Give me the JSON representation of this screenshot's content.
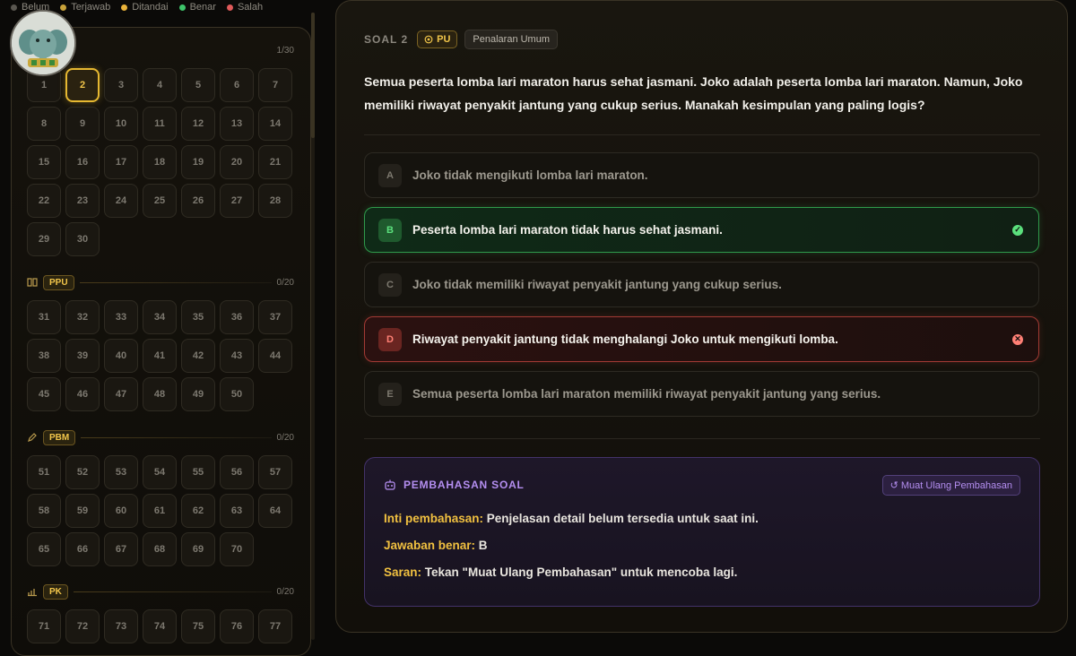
{
  "legend": [
    {
      "label": "Belum",
      "color": "#5a5750"
    },
    {
      "label": "Terjawab",
      "color": "#c8a23a"
    },
    {
      "label": "Ditandai",
      "color": "#e8b23a"
    },
    {
      "label": "Benar",
      "color": "#3ec46a"
    },
    {
      "label": "Salah",
      "color": "#e05a5a"
    }
  ],
  "sections": [
    {
      "tag": "",
      "icon": "",
      "count": "1/30",
      "start": 1,
      "end": 30,
      "active": 2
    },
    {
      "tag": "PPU",
      "icon": "book-icon",
      "count": "0/20",
      "start": 31,
      "end": 50
    },
    {
      "tag": "PBM",
      "icon": "pencil-icon",
      "count": "0/20",
      "start": 51,
      "end": 70
    },
    {
      "tag": "PK",
      "icon": "chart-icon",
      "count": "0/20",
      "start": 71,
      "end": 77
    }
  ],
  "question": {
    "number_label": "SOAL 2",
    "pu_badge": "PU",
    "category": "Penalaran Umum",
    "text": "Semua peserta lomba lari maraton harus sehat jasmani. Joko adalah peserta lomba lari maraton. Namun, Joko memiliki riwayat penyakit jantung yang cukup serius. Manakah kesimpulan yang paling logis?"
  },
  "options": [
    {
      "letter": "A",
      "text": "Joko tidak mengikuti lomba lari maraton.",
      "state": "none"
    },
    {
      "letter": "B",
      "text": "Peserta lomba lari maraton tidak harus sehat jasmani.",
      "state": "correct"
    },
    {
      "letter": "C",
      "text": "Joko tidak memiliki riwayat penyakit jantung yang cukup serius.",
      "state": "none"
    },
    {
      "letter": "D",
      "text": "Riwayat penyakit jantung tidak menghalangi Joko untuk mengikuti lomba.",
      "state": "wrong"
    },
    {
      "letter": "E",
      "text": "Semua peserta lomba lari maraton memiliki riwayat penyakit jantung yang serius.",
      "state": "none"
    }
  ],
  "explanation": {
    "title": "PEMBAHASAN SOAL",
    "reload_label": "↺ Muat Ulang Pembahasan",
    "inti_key": "Inti pembahasan:",
    "inti_val": " Penjelasan detail belum tersedia untuk saat ini.",
    "jawaban_key": "Jawaban benar:",
    "jawaban_val": " B",
    "saran_key": "Saran:",
    "saran_val": " Tekan \"Muat Ulang Pembahasan\" untuk mencoba lagi."
  },
  "colors": {
    "accent": "#e6b831",
    "correct": "#2f9a4b",
    "wrong": "#a23a34",
    "purple": "#b48ef0"
  }
}
